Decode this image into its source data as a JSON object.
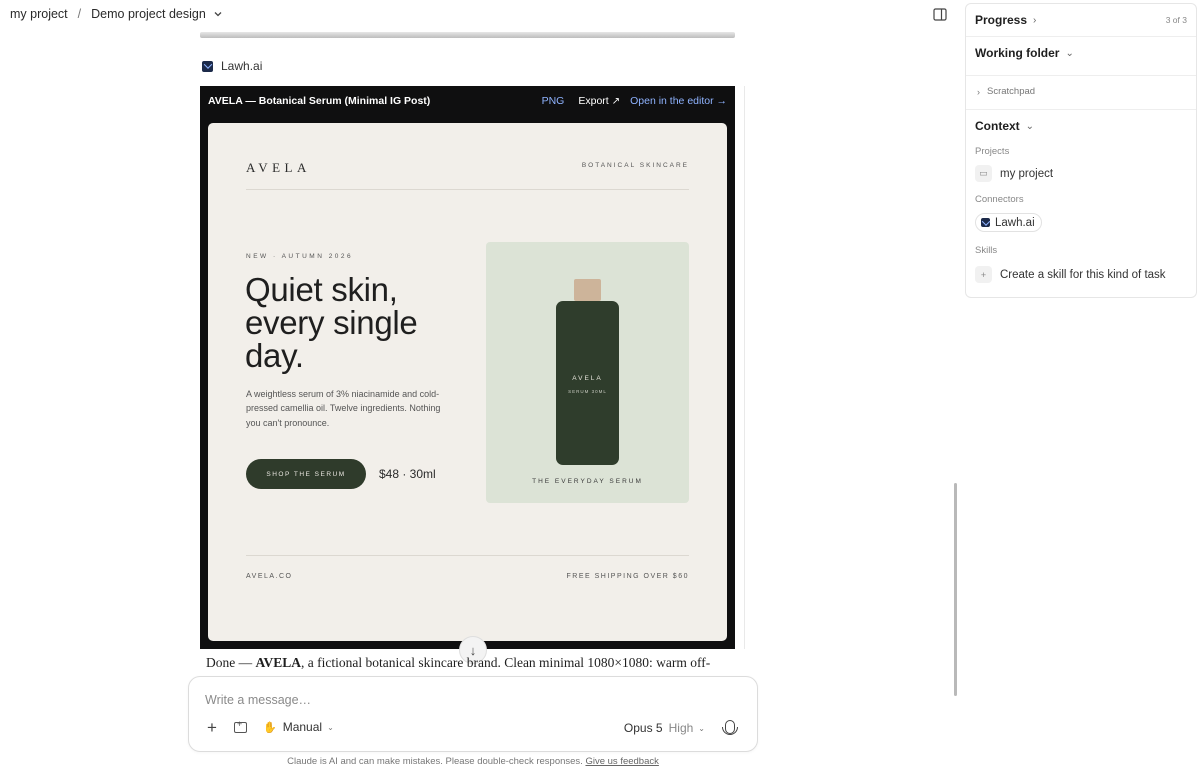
{
  "header": {
    "project": "my project",
    "separator": "/",
    "design": "Demo project design"
  },
  "chat": {
    "connector_label": "Lawh.ai",
    "artifact": {
      "title": "AVELA — Botanical Serum (Minimal IG Post)",
      "png": "PNG",
      "export": "Export",
      "open_editor": "Open in the editor →"
    },
    "post": {
      "brand": "AVELA",
      "tagline": "BOTANICAL SKINCARE",
      "eyebrow": "NEW · AUTUMN 2026",
      "headline": "Quiet skin, every single day.",
      "description": "A weightless serum of 3% niacinamide and cold-pressed camellia oil. Twelve ingredients. Nothing you can't pronounce.",
      "cta": "SHOP THE SERUM",
      "price": "$48 · 30ml",
      "bottle_brand": "AVELA",
      "bottle_sub": "SERUM 30ML",
      "product_caption": "THE EVERYDAY SERUM",
      "site": "AVELA.CO",
      "shipping": "FREE SHIPPING OVER $60",
      "colors": {
        "background": "#f2efea",
        "forest": "#2f3d2c",
        "sage": "#dce3d6",
        "cap": "#cdb49a"
      }
    },
    "message": {
      "prefix": "Done — ",
      "brand": "AVELA",
      "rest": ", a fictional botanical skincare brand. Clean minimal 1080×1080: warm off-"
    }
  },
  "composer": {
    "placeholder": "Write a message…",
    "mode": "Manual",
    "model": "Opus 5",
    "effort": "High"
  },
  "footer": {
    "disclaimer": "Claude is AI and can make mistakes. Please double-check responses.",
    "feedback": "Give us feedback"
  },
  "panel": {
    "progress": "Progress",
    "progress_count": "3 of 3",
    "working_folder": "Working folder",
    "scratchpad": "Scratchpad",
    "context": "Context",
    "projects_label": "Projects",
    "project_item": "my project",
    "connectors_label": "Connectors",
    "connector_item": "Lawh.ai",
    "skills_label": "Skills",
    "skill_item": "Create a skill for this kind of task"
  }
}
